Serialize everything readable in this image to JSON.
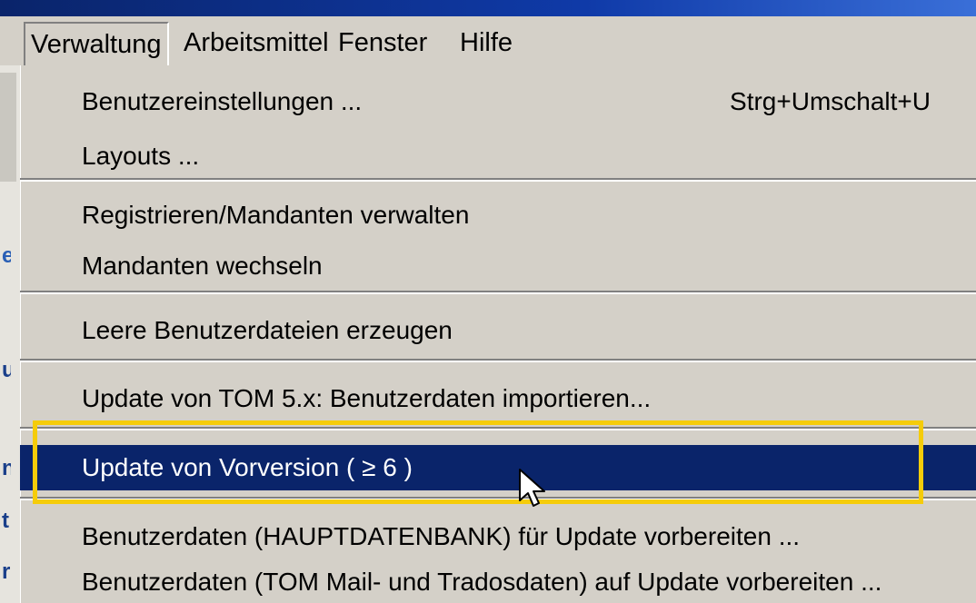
{
  "menubar": {
    "items": [
      "Verwaltung",
      "Arbeitsmittel",
      "Fenster",
      "Hilfe"
    ],
    "active": "Verwaltung"
  },
  "dropdown": {
    "groups": [
      [
        {
          "label": "Benutzereinstellungen ...",
          "shortcut": "Strg+Umschalt+U"
        },
        {
          "label": "Layouts ..."
        }
      ],
      [
        {
          "label": "Registrieren/Mandanten verwalten"
        },
        {
          "label": "Mandanten wechseln"
        }
      ],
      [
        {
          "label": "Leere Benutzerdateien erzeugen"
        }
      ],
      [
        {
          "label": "Update von TOM 5.x: Benutzerdaten importieren..."
        }
      ],
      [
        {
          "label": "Update von Vorversion (  ≥ 6 )",
          "highlighted": true
        }
      ],
      [
        {
          "label": "Benutzerdaten (HAUPTDATENBANK) für Update vorbereiten ..."
        },
        {
          "label": "Benutzerdaten (TOM Mail- und Tradosdaten) auf Update vorbereiten ..."
        }
      ]
    ]
  },
  "colors": {
    "menu_bg": "#d4d0c8",
    "highlight_bg": "#0a246a",
    "callout_border": "#f5cc0a",
    "title_blue": "#0a246a"
  },
  "icons": [
    "mouse-pointer-icon"
  ]
}
